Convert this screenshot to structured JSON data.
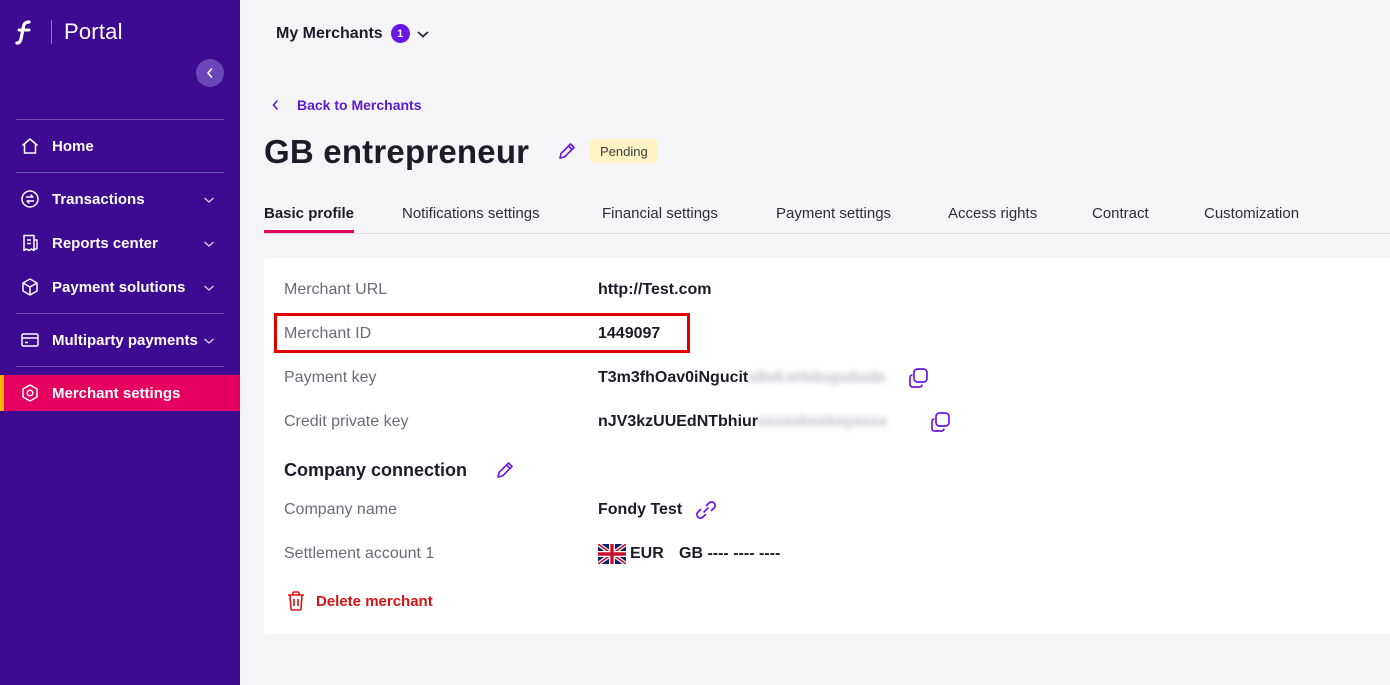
{
  "app": {
    "brand_logo_letter": "f",
    "brand_title": "Portal"
  },
  "sidebar": {
    "items": [
      {
        "label": "Home",
        "icon": "home-icon",
        "expandable": false
      },
      {
        "label": "Transactions",
        "icon": "transactions-icon",
        "expandable": true
      },
      {
        "label": "Reports center",
        "icon": "report-icon",
        "expandable": true
      },
      {
        "label": "Payment solutions",
        "icon": "box-icon",
        "expandable": true
      },
      {
        "label": "Multiparty payments",
        "icon": "card-icon",
        "expandable": true
      },
      {
        "label": "Merchant settings",
        "icon": "settings-icon",
        "expandable": false,
        "active": true
      }
    ]
  },
  "header": {
    "merchants_label": "My Merchants",
    "merchants_count": "1"
  },
  "page": {
    "back_label": "Back to Merchants",
    "title": "GB entrepreneur",
    "status": "Pending"
  },
  "tabs": [
    {
      "label": "Basic profile",
      "active": true
    },
    {
      "label": "Notifications settings"
    },
    {
      "label": "Financial settings"
    },
    {
      "label": "Payment settings"
    },
    {
      "label": "Access rights"
    },
    {
      "label": "Contract"
    },
    {
      "label": "Customization"
    }
  ],
  "profile": {
    "merchant_url": {
      "label": "Merchant URL",
      "value": "http://Test.com"
    },
    "merchant_id": {
      "label": "Merchant ID",
      "value": "1449097"
    },
    "payment_key": {
      "label": "Payment key",
      "value": "T3m3fhOav0iNgucit"
    },
    "credit_private_key": {
      "label": "Credit private key",
      "value": "nJV3kzUUEdNTbhiur"
    }
  },
  "company": {
    "section_title": "Company connection",
    "company_name": {
      "label": "Company name",
      "value": "Fondy Test"
    },
    "settlement": {
      "label": "Settlement account 1",
      "currency": "EUR",
      "iban": "GB ---- ---- ----"
    }
  },
  "actions": {
    "delete_label": "Delete merchant"
  },
  "colors": {
    "sidebar_bg": "#3d0a91",
    "active_item": "#e5005f",
    "accent": "#6a17e6",
    "danger": "#d41418",
    "pending_bg": "#fff3c4"
  }
}
